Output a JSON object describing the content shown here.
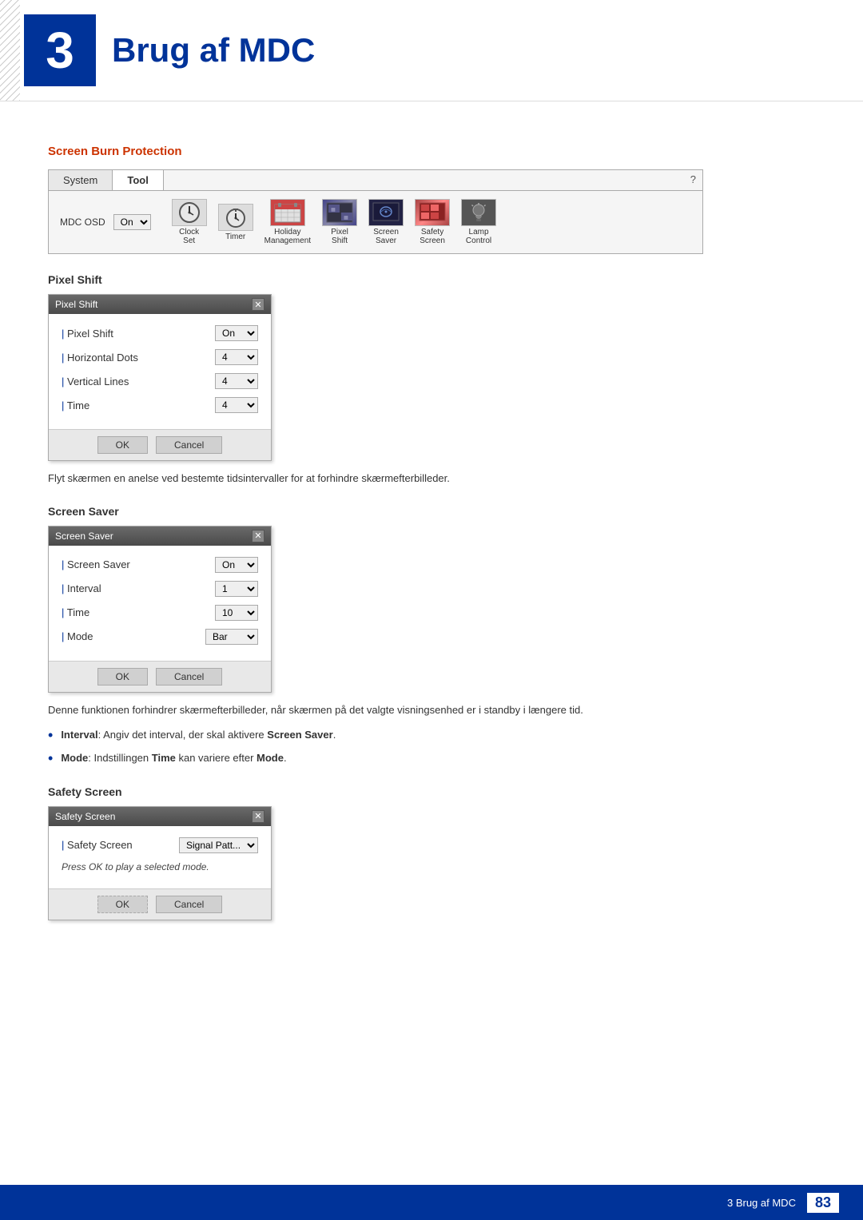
{
  "header": {
    "chapter_number": "3",
    "chapter_title": "Brug af MDC"
  },
  "sections": {
    "screen_burn_protection": {
      "heading": "Screen Burn Protection",
      "toolbar": {
        "tabs": [
          "System",
          "Tool"
        ],
        "active_tab": "Tool",
        "help_label": "?",
        "mdc_osd_label": "MDC OSD",
        "mdc_osd_value": "On",
        "icons": [
          {
            "name": "Clock Set",
            "type": "clock"
          },
          {
            "name": "Timer",
            "type": "timer"
          },
          {
            "name": "Holiday Management",
            "type": "holiday"
          },
          {
            "name": "Pixel Shift",
            "type": "pixel"
          },
          {
            "name": "Screen Saver",
            "type": "screen-saver"
          },
          {
            "name": "Safety Screen",
            "type": "safety"
          },
          {
            "name": "Lamp Control",
            "type": "lamp"
          }
        ]
      }
    },
    "pixel_shift": {
      "heading": "Pixel Shift",
      "dialog_title": "Pixel Shift",
      "rows": [
        {
          "label": "Pixel Shift",
          "value": "On"
        },
        {
          "label": "Horizontal Dots",
          "value": "4"
        },
        {
          "label": "Vertical Lines",
          "value": "4"
        },
        {
          "label": "Time",
          "value": "4"
        }
      ],
      "ok_label": "OK",
      "cancel_label": "Cancel",
      "description": "Flyt skærmen en anelse ved bestemte tidsintervaller for at forhindre skærmefterbilleder."
    },
    "screen_saver": {
      "heading": "Screen Saver",
      "dialog_title": "Screen Saver",
      "rows": [
        {
          "label": "Screen Saver",
          "value": "On"
        },
        {
          "label": "Interval",
          "value": "1"
        },
        {
          "label": "Time",
          "value": "10"
        },
        {
          "label": "Mode",
          "value": "Bar"
        }
      ],
      "ok_label": "OK",
      "cancel_label": "Cancel",
      "description": "Denne funktionen forhindrer skærmefterbilleder, når skærmen på det valgte visningsenhed er i standby i længere tid.",
      "bullets": [
        {
          "term": "Interval",
          "colon": ": ",
          "text_before": "Angiv det interval, der skal aktivere ",
          "bold_word": "Screen Saver",
          "text_after": "."
        },
        {
          "term": "Mode",
          "colon": ": ",
          "text_before": "Indstillingen ",
          "bold_word": "Time",
          "text_after": " kan variere efter ",
          "bold_word2": "Mode",
          "text_after2": "."
        }
      ]
    },
    "safety_screen": {
      "heading": "Safety Screen",
      "dialog_title": "Safety Screen",
      "rows": [
        {
          "label": "Safety Screen",
          "value": "Signal Patt..."
        }
      ],
      "note": "Press OK to play a selected mode.",
      "ok_label": "OK",
      "cancel_label": "Cancel"
    }
  },
  "footer": {
    "text": "3 Brug af MDC",
    "page_number": "83"
  }
}
